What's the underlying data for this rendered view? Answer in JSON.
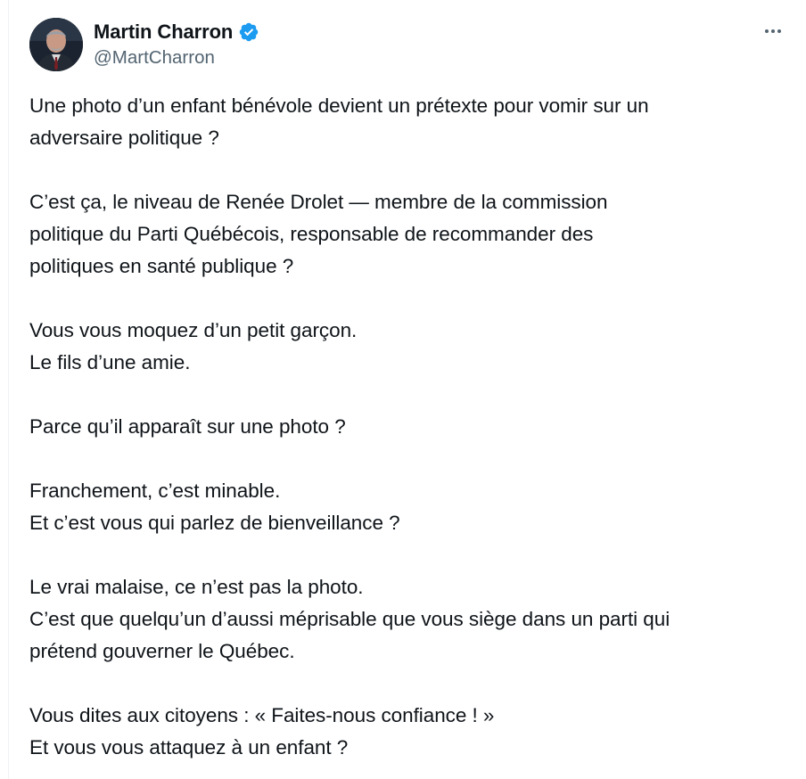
{
  "author": {
    "display_name": "Martin Charron",
    "handle": "@MartCharron",
    "verified": true,
    "verified_color": "#1d9bf0"
  },
  "tweet": {
    "paragraphs": [
      "Une photo d’un enfant bénévole devient un prétexte pour vomir sur un\nadversaire politique ?",
      "C’est ça, le niveau de Renée Drolet — membre de la commission\npolitique du Parti Québécois, responsable de recommander des\npolitiques en santé publique ?",
      "Vous vous moquez d’un petit garçon.\nLe fils d’une amie.",
      "Parce qu’il apparaît sur une photo ?",
      "Franchement, c’est minable.\nEt c’est vous qui parlez de bienveillance ?",
      "Le vrai malaise, ce n’est pas la photo.\nC’est que quelqu’un d’aussi méprisable que vous siège dans un parti qui\nprétend gouverner le Québec.",
      "Vous dites aux citoyens : « Faites-nous confiance ! »\nEt vous vous attaquez à un enfant ?"
    ]
  },
  "icons": {
    "verified": "verified-badge-icon",
    "more": "more-horizontal-icon"
  },
  "colors": {
    "text": "#0f1419",
    "secondary": "#536471",
    "accent": "#1d9bf0"
  }
}
